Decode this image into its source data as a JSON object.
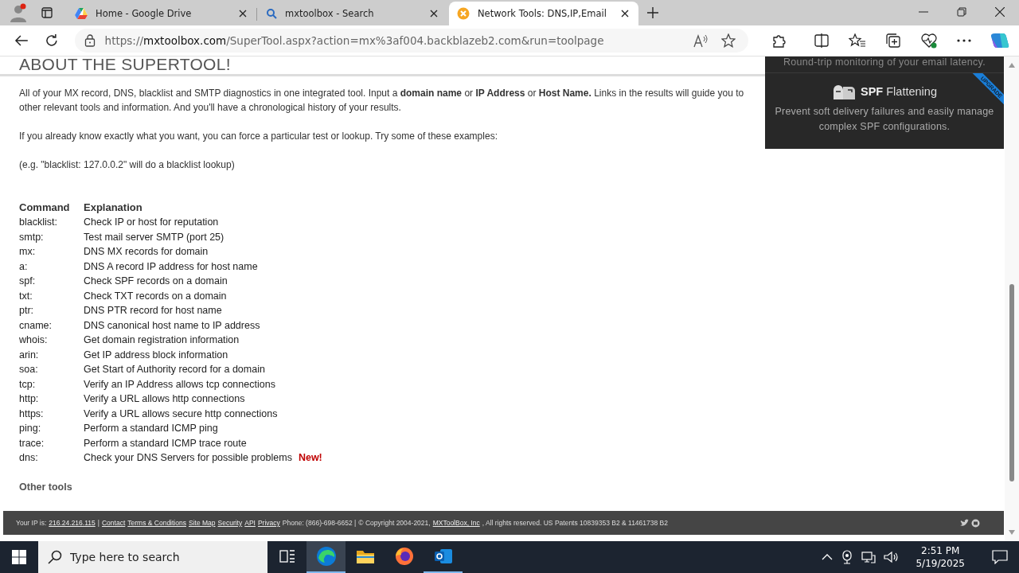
{
  "browser": {
    "tabs": [
      {
        "kind": "drive",
        "title": "Home - Google Drive",
        "selected": false
      },
      {
        "kind": "search",
        "title": "mxtoolbox - Search",
        "selected": false
      },
      {
        "kind": "mxtoolbox",
        "title": "Network Tools: DNS,IP,Email",
        "selected": true
      }
    ],
    "url": {
      "scheme": "https://",
      "host": "mxtoolbox.com",
      "path": "/SuperTool.aspx?action=mx%3af004.backblazeb2.com&run=toolpage"
    }
  },
  "page": {
    "heading": "ABOUT THE SUPERTOOL!",
    "paragraphs": [
      "All of your MX record, DNS, blacklist and SMTP diagnostics in one integrated tool.  Input a **domain name** or **IP Address** or **Host Name.** Links in the results will guide you to other relevant tools and information.  And you'll have a chronological history of your results.",
      "If you already know exactly what you want, you can force a particular test or lookup.  Try some of these examples:",
      "(e.g. \"blacklist: 127.0.0.2\" will do a blacklist lookup)"
    ],
    "table": {
      "columns": [
        "Command",
        "Explanation"
      ],
      "rows": [
        {
          "command": "blacklist:",
          "explanation": "Check IP or host for reputation"
        },
        {
          "command": "smtp:",
          "explanation": "Test mail server SMTP (port 25)"
        },
        {
          "command": "mx:",
          "explanation": "DNS MX records for domain"
        },
        {
          "command": "a:",
          "explanation": "DNS A record IP address for host name"
        },
        {
          "command": "spf:",
          "explanation": "Check SPF records on a domain"
        },
        {
          "command": "txt:",
          "explanation": "Check TXT records on a domain"
        },
        {
          "command": "ptr:",
          "explanation": "DNS PTR record for host name"
        },
        {
          "command": "cname:",
          "explanation": "DNS canonical host name to IP address"
        },
        {
          "command": "whois:",
          "explanation": "Get domain registration information"
        },
        {
          "command": "arin:",
          "explanation": "Get IP address block information"
        },
        {
          "command": "soa:",
          "explanation": "Get Start of Authority record for a domain"
        },
        {
          "command": "tcp:",
          "explanation": "Verify an IP Address allows tcp connections"
        },
        {
          "command": "http:",
          "explanation": "Verify a URL allows http connections"
        },
        {
          "command": "https:",
          "explanation": "Verify a URL allows secure http connections"
        },
        {
          "command": "ping:",
          "explanation": "Perform a standard ICMP ping"
        },
        {
          "command": "trace:",
          "explanation": "Perform a standard ICMP trace route"
        },
        {
          "command": "dns:",
          "explanation": "Check your DNS Servers for possible problems",
          "badge": "New!"
        }
      ]
    },
    "other_tools": "Other tools"
  },
  "sidebar": {
    "latency_text": "Round-trip monitoring of your email latency.",
    "promo": {
      "title_bold": "SPF",
      "title_rest": "Flattening",
      "description": "Prevent soft delivery failures and easily manage complex SPF configurations.",
      "ribbon": "UPGRADE"
    }
  },
  "footer": [
    {
      "kind": "text",
      "text": "Your IP is:"
    },
    {
      "kind": "link",
      "text": "216.24.216.115"
    },
    {
      "kind": "text",
      "text": "|"
    },
    {
      "kind": "link",
      "text": "Contact"
    },
    {
      "kind": "link",
      "text": "Terms & Conditions"
    },
    {
      "kind": "link",
      "text": "Site Map"
    },
    {
      "kind": "link",
      "text": "Security"
    },
    {
      "kind": "link",
      "text": "API"
    },
    {
      "kind": "link",
      "text": "Privacy"
    },
    {
      "kind": "text",
      "text": "Phone: (866)-698-6652 |"
    },
    {
      "kind": "text",
      "text": "© Copyright 2004-2021,"
    },
    {
      "kind": "link",
      "text": "MXToolBox, Inc"
    },
    {
      "kind": "text",
      "text": ", All rights reserved. US Patents 10839353 B2 & 11461738 B2"
    }
  ],
  "taskbar": {
    "search_placeholder": "Type here to search",
    "apps": [
      {
        "kind": "taskview",
        "selected": false,
        "running": false
      },
      {
        "kind": "edge",
        "selected": true,
        "running": true
      },
      {
        "kind": "explorer",
        "selected": false,
        "running": false
      },
      {
        "kind": "firefox",
        "selected": false,
        "running": false
      },
      {
        "kind": "outlook",
        "selected": false,
        "running": true
      }
    ],
    "time": "2:51 PM",
    "date": "5/19/2025"
  }
}
